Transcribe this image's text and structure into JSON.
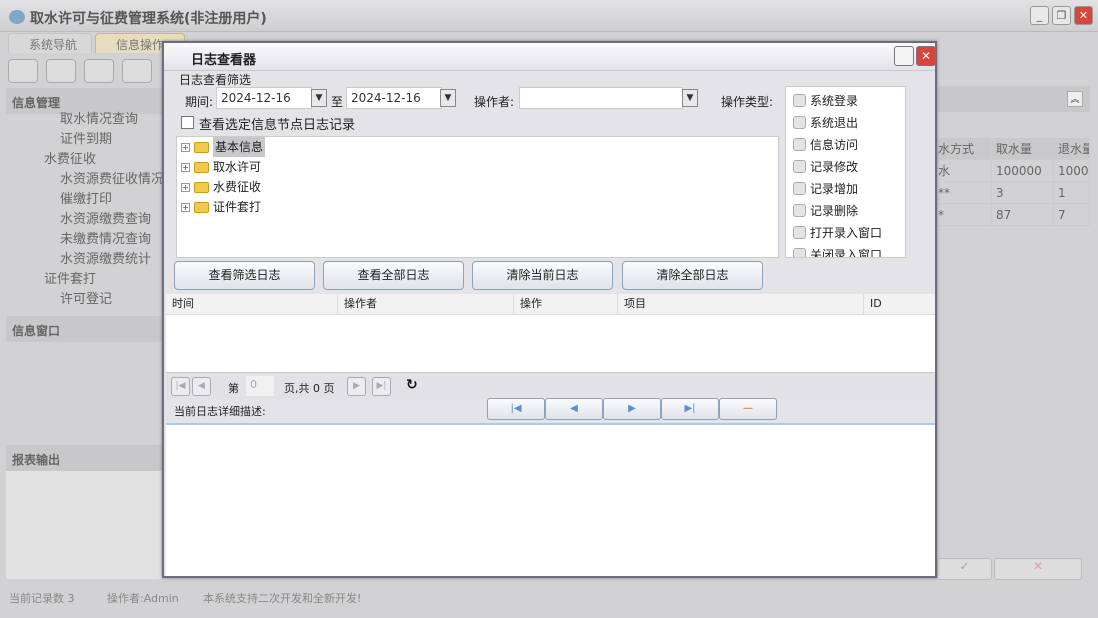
{
  "app": {
    "title": "取水许可与征费管理系统(非注册用户)"
  },
  "tabs": [
    {
      "label": "系统导航"
    },
    {
      "label": "信息操作"
    }
  ],
  "sidebar": {
    "info_mgmt": "信息管理",
    "items": [
      {
        "label": "取水情况查询",
        "level": 2
      },
      {
        "label": "证件到期",
        "level": 2
      },
      {
        "label": "水费征收",
        "level": 0
      },
      {
        "label": "水资源费征收情况",
        "level": 1
      },
      {
        "label": "催缴打印",
        "level": 1
      },
      {
        "label": "水资源缴费查询",
        "level": 1
      },
      {
        "label": "未缴费情况查询",
        "level": 2
      },
      {
        "label": "水资源缴费统计",
        "level": 2
      },
      {
        "label": "证件套打",
        "level": 0
      },
      {
        "label": "许可登记",
        "level": 1
      }
    ],
    "info_window": "信息窗口",
    "report_output": "报表输出"
  },
  "grid": {
    "headers": [
      "水方式",
      "取水量",
      "退水量"
    ],
    "rows": [
      [
        "水",
        "100000",
        "1000"
      ],
      [
        "**",
        "3",
        "1"
      ],
      [
        "*",
        "87",
        "7"
      ]
    ]
  },
  "status": {
    "record_count": "当前记录数 3",
    "operator": "操作者:Admin",
    "message": "本系统支持二次开发和全新开发!"
  },
  "dialog": {
    "title": "日志查看器",
    "filter_label": "日志查看筛选",
    "period_label": "期间:",
    "date_from": "2024-12-16",
    "to_label": "至",
    "date_to": "2024-12-16",
    "operator_label": "操作者:",
    "operator_value": "",
    "optype_label": "操作类型:",
    "node_checkbox": "查看选定信息节点日志记录",
    "tree": [
      {
        "label": "基本信息",
        "selected": true
      },
      {
        "label": "取水许可"
      },
      {
        "label": "水费征收"
      },
      {
        "label": "证件套打"
      }
    ],
    "op_types": [
      "系统登录",
      "系统退出",
      "信息访问",
      "记录修改",
      "记录增加",
      "记录删除",
      "打开录入窗口",
      "关闭录入窗口"
    ],
    "buttons": [
      "查看筛选日志",
      "查看全部日志",
      "清除当前日志",
      "清除全部日志"
    ],
    "columns": [
      "时间",
      "操作者",
      "操作",
      "项目",
      "ID"
    ],
    "pager": {
      "page_prefix": "第",
      "page": "0",
      "page_suffix": "页,共 0 页"
    },
    "detail_label": "当前日志详细描述:"
  }
}
